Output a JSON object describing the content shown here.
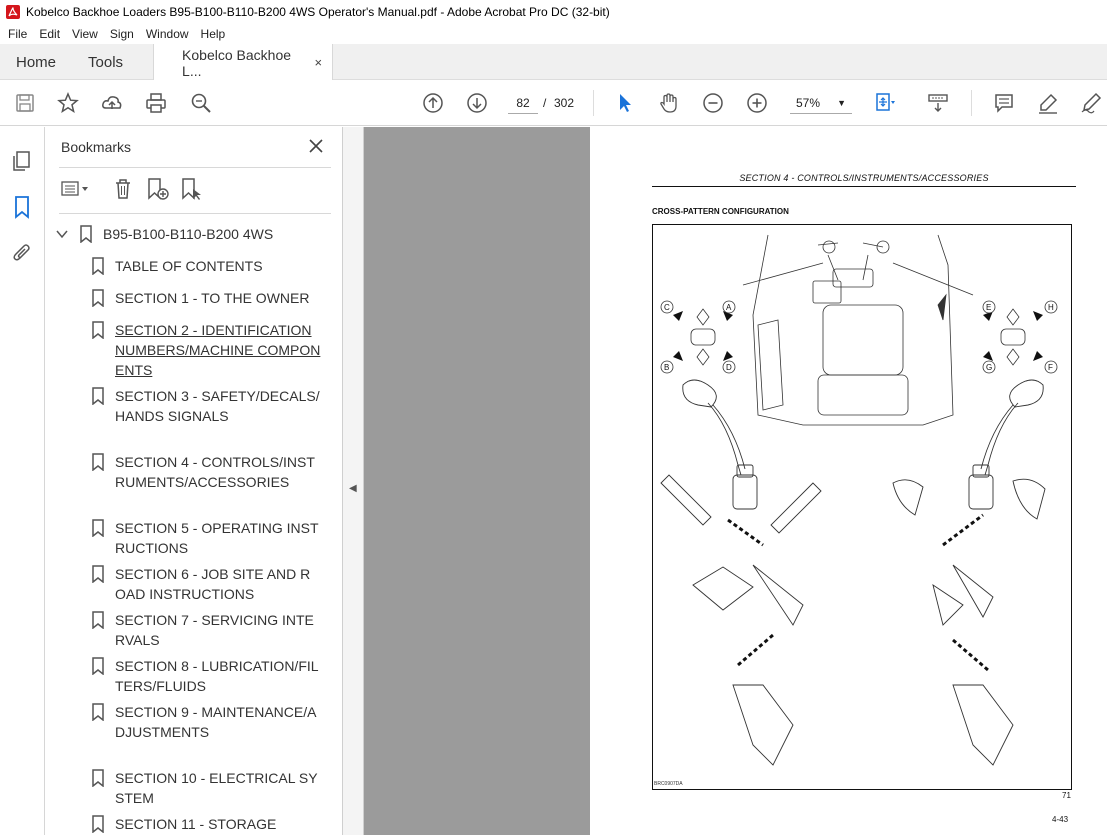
{
  "window": {
    "title": "Kobelco Backhoe Loaders B95-B100-B110-B200 4WS Operator's Manual.pdf - Adobe Acrobat Pro DC (32-bit)"
  },
  "menu": [
    "File",
    "Edit",
    "View",
    "Sign",
    "Window",
    "Help"
  ],
  "tabs": {
    "home": "Home",
    "tools": "Tools",
    "document": "Kobelco Backhoe L...",
    "close": "×"
  },
  "toolbar": {
    "current_page": "82",
    "separator": "/",
    "total_pages": "302",
    "zoom": "57%"
  },
  "bookmarks": {
    "title": "Bookmarks",
    "root": "B95-B100-B110-B200 4WS",
    "items": [
      {
        "label": "TABLE OF CONTENTS"
      },
      {
        "label": "SECTION 1 - TO THE OWNER"
      },
      {
        "label": "SECTION 2 - IDENTIFICATION NUMBERS/MACHINE COMPONENTS"
      },
      {
        "label": "SECTION 3 - SAFETY/DECALS/HANDS SIGNALS"
      },
      {
        "label": "SECTION 4 - CONTROLS/INSTRUMENTS/ACCESSORIES"
      },
      {
        "label": "SECTION 5 - OPERATING INSTRUCTIONS"
      },
      {
        "label": "SECTION 6 - JOB SITE AND ROAD INSTRUCTIONS"
      },
      {
        "label": "SECTION 7 - SERVICING INTERVALS"
      },
      {
        "label": "SECTION 8 - LUBRICATION/FILTERS/FLUIDS"
      },
      {
        "label": "SECTION 9 - MAINTENANCE/ADJUSTMENTS"
      },
      {
        "label": "SECTION 10 - ELECTRICAL SYSTEM"
      },
      {
        "label": "SECTION 11 - STORAGE"
      }
    ]
  },
  "page": {
    "section_title": "SECTION 4 - CONTROLS/INSTRUMENTS/ACCESSORIES",
    "subtitle": "CROSS-PATTERN CONFIGURATION",
    "figure_code": "BRC0907DA",
    "figure_number": "71",
    "page_number": "4-43",
    "labels": [
      "A",
      "B",
      "C",
      "D",
      "E",
      "F",
      "G",
      "H"
    ]
  }
}
